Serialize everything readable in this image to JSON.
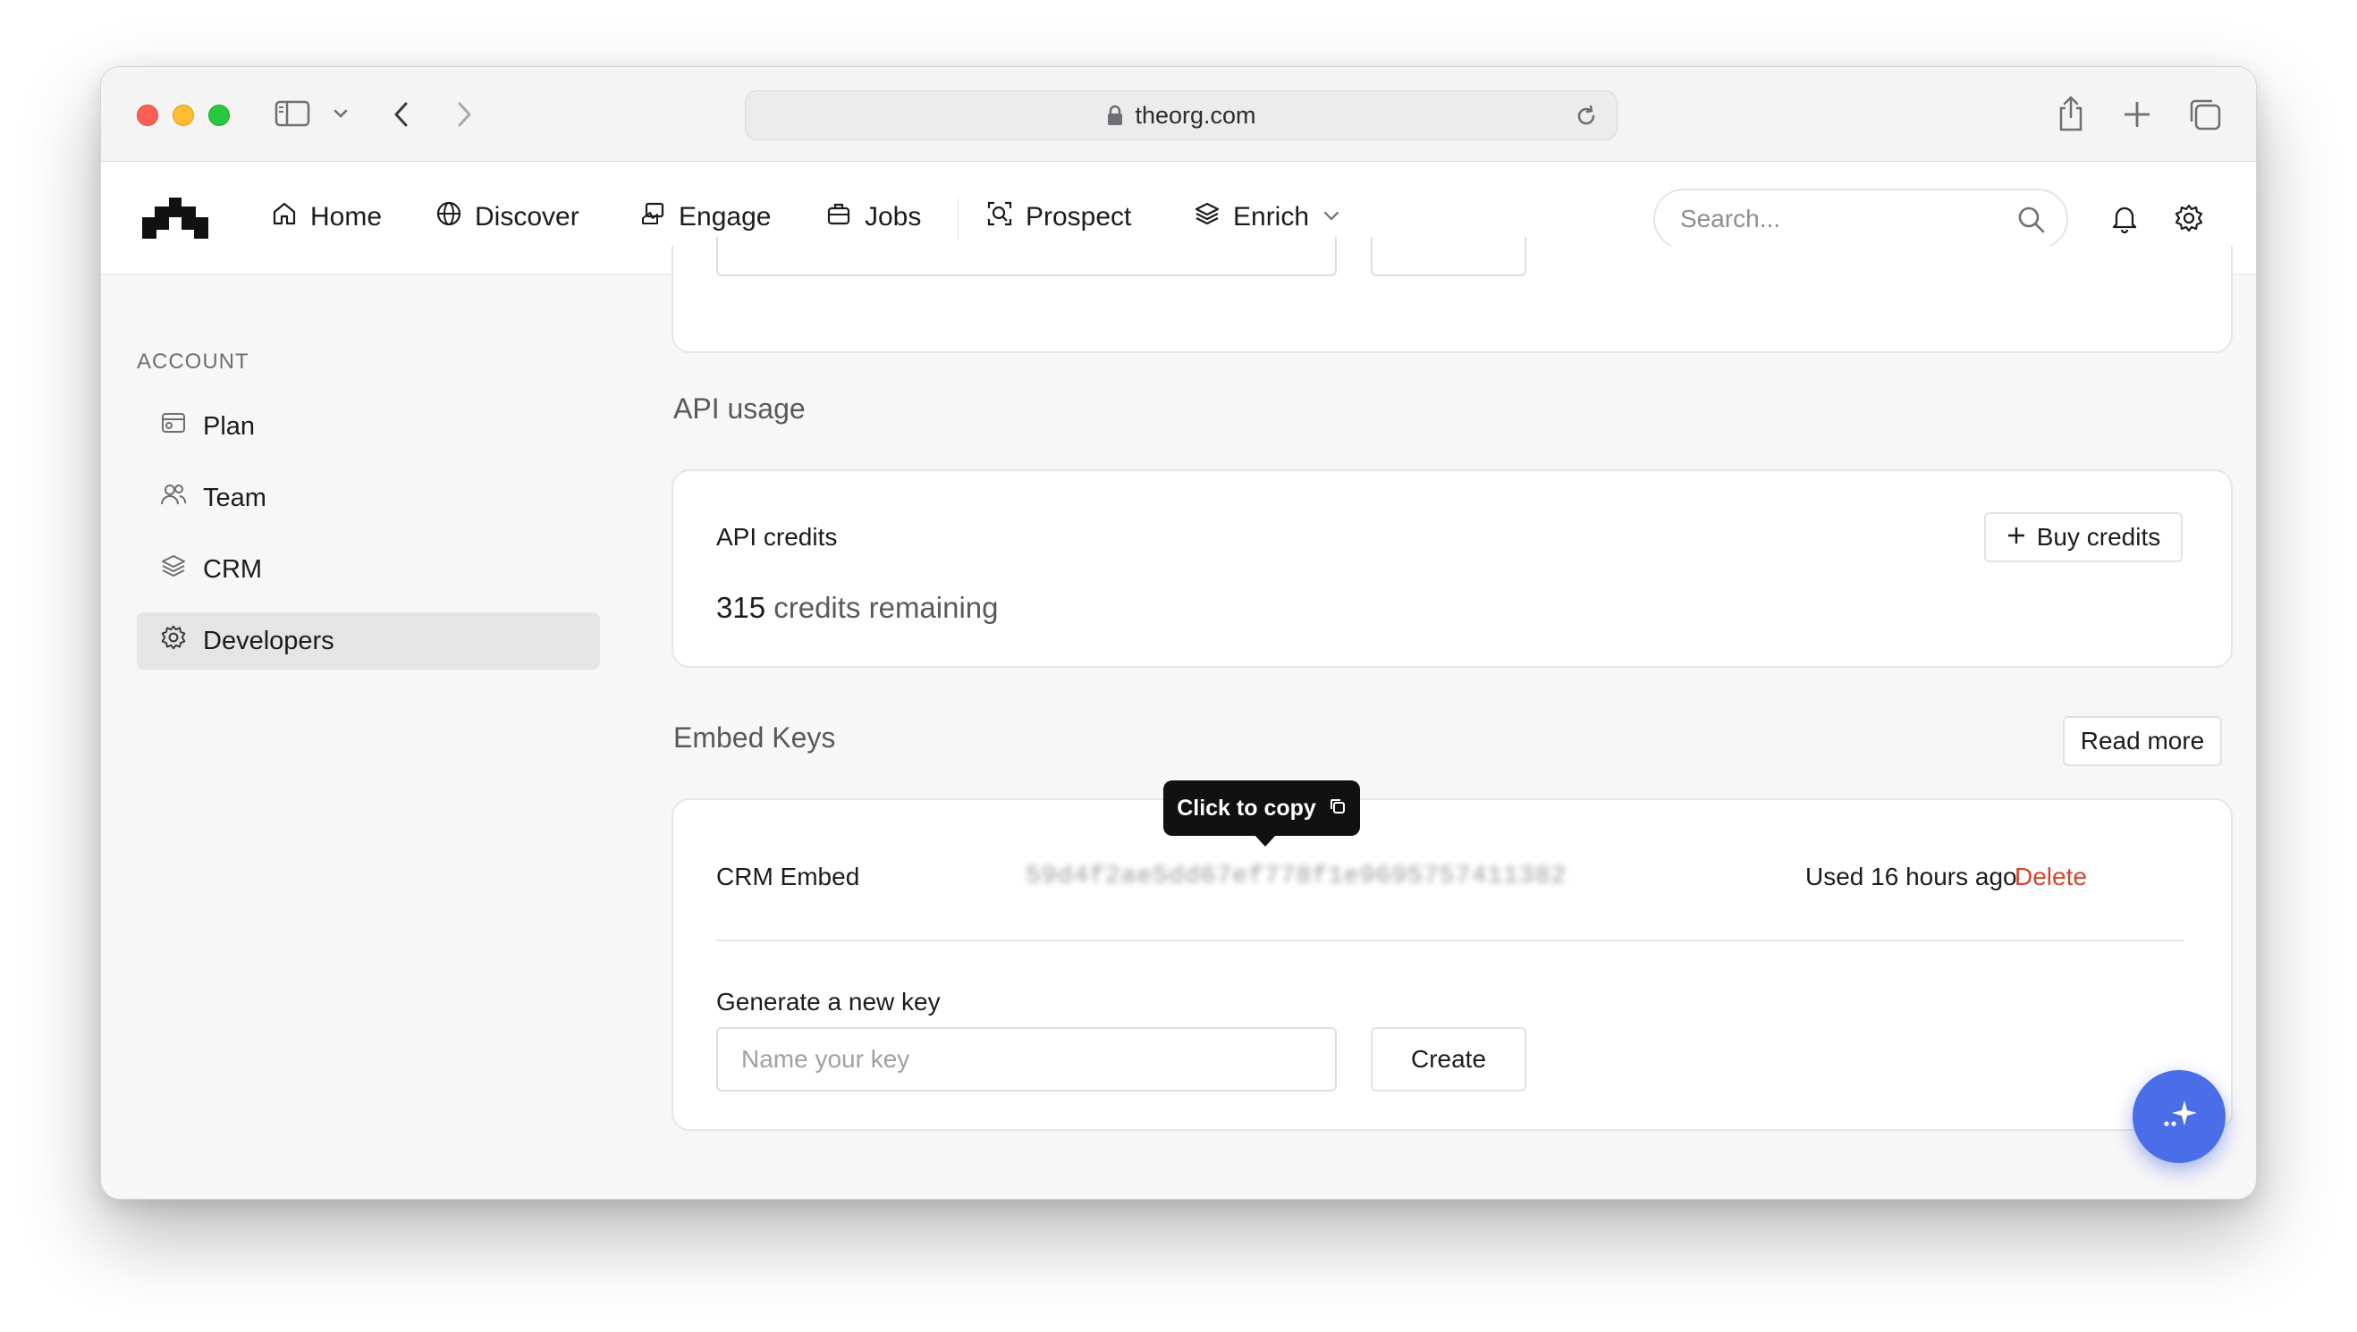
{
  "browser": {
    "url": "theorg.com"
  },
  "nav": {
    "items": [
      {
        "label": "Home",
        "icon": "home-icon"
      },
      {
        "label": "Discover",
        "icon": "globe-icon"
      },
      {
        "label": "Engage",
        "icon": "engage-icon"
      },
      {
        "label": "Jobs",
        "icon": "briefcase-icon"
      },
      {
        "label": "Prospect",
        "icon": "prospect-icon"
      },
      {
        "label": "Enrich",
        "icon": "layers-icon"
      }
    ],
    "search_placeholder": "Search..."
  },
  "sidebar": {
    "heading": "ACCOUNT",
    "items": [
      {
        "label": "Plan",
        "icon": "plan-icon"
      },
      {
        "label": "Team",
        "icon": "team-icon"
      },
      {
        "label": "CRM",
        "icon": "layers-icon"
      },
      {
        "label": "Developers",
        "icon": "gear-icon",
        "active": true
      }
    ]
  },
  "api_usage": {
    "section_title": "API usage",
    "card_title": "API credits",
    "buy_label": "Buy credits",
    "credits_count": "315",
    "credits_suffix": "credits remaining"
  },
  "embed_keys": {
    "section_title": "Embed Keys",
    "read_more_label": "Read more",
    "keys": [
      {
        "name": "CRM Embed",
        "key_masked": "59d4f2ae5dd67ef778f1e9695757411382",
        "used": "Used 16 hours ago",
        "delete_label": "Delete"
      }
    ],
    "tooltip": "Click to copy",
    "generate_label": "Generate a new key",
    "input_placeholder": "Name your key",
    "create_label": "Create"
  },
  "colors": {
    "accent": "#4a6ee8",
    "delete": "#d9432c",
    "active_bg": "#e5e5e5"
  }
}
